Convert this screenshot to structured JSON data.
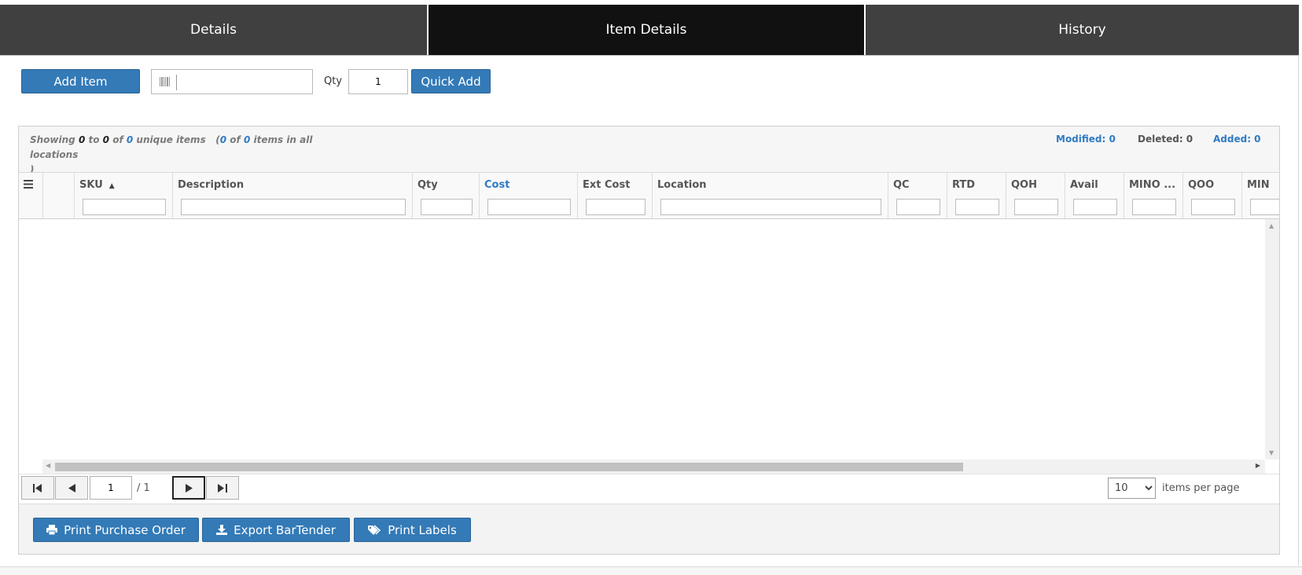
{
  "tabs": [
    {
      "label": "Details"
    },
    {
      "label": "Item Details"
    },
    {
      "label": "History"
    }
  ],
  "toolbar": {
    "add_item_label": "Add Item",
    "barcode_value": "",
    "qty_label": "Qty",
    "qty_value": "1",
    "quick_add_label": "Quick Add"
  },
  "summary": {
    "showing": "Showing",
    "from": "0",
    "to_word": "to",
    "to": "0",
    "of_word": "of",
    "total": "0",
    "unique_items": "unique items",
    "open_paren": "(",
    "loc_count": "0",
    "loc_of": "of",
    "loc_total": "0",
    "loc_label": "items in all locations",
    "close_paren": ")",
    "modified": "Modified: 0",
    "deleted": "Deleted: 0",
    "added": "Added: 0"
  },
  "columns": [
    {
      "label": "SKU",
      "sorted": "ascending"
    },
    {
      "label": "Description"
    },
    {
      "label": "Qty"
    },
    {
      "label": "Cost"
    },
    {
      "label": "Ext Cost"
    },
    {
      "label": "Location"
    },
    {
      "label": "QC"
    },
    {
      "label": "RTD"
    },
    {
      "label": "QOH"
    },
    {
      "label": "Avail"
    },
    {
      "label": "MINO ..."
    },
    {
      "label": "QOO"
    },
    {
      "label": "MIN"
    }
  ],
  "pager": {
    "page": "1",
    "total_pages": "/ 1",
    "per_page": "10",
    "per_page_label": "items per page"
  },
  "footer": {
    "print_po_label": "Print Purchase Order",
    "export_label": "Export BarTender",
    "print_labels_label": "Print Labels"
  },
  "colors": {
    "primary_button": "#337ab7",
    "tab_bg": "#404040",
    "tab_active_bg": "#111111",
    "link_blue": "#2f7bc4"
  }
}
